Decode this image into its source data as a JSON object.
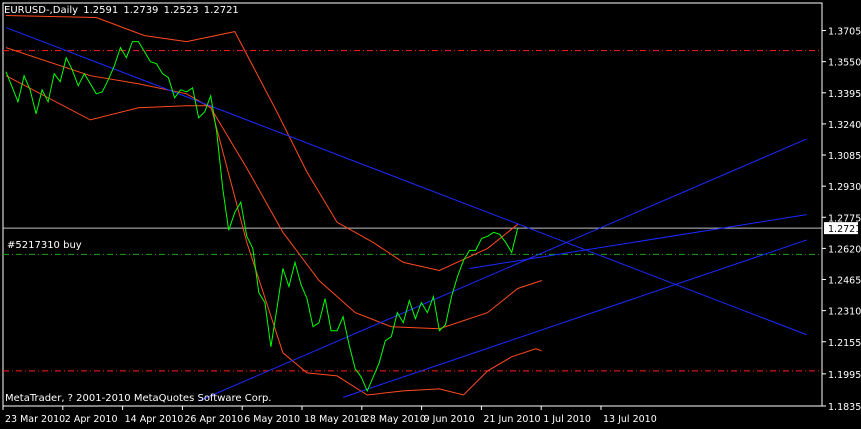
{
  "header": {
    "symbol": "EURUSD-,Daily",
    "open": "1.2591",
    "high": "1.2739",
    "low": "1.2523",
    "close": "1.2721"
  },
  "order_label": "#5217310 buy",
  "copyright": "MetaTrader, ? 2001-2010 MetaQuotes Software Corp.",
  "current_price": "1.2721",
  "colors": {
    "background": "#000000",
    "price": "#00ff00",
    "bands": "#ff4a1f",
    "trendlines": "#1a2aff",
    "levels": "#ff1e1e",
    "order_level": "#1fa01f",
    "current_price": "#c0c0c0",
    "text": "#ffffff"
  },
  "chart_data": {
    "type": "line",
    "symbol": "EURUSD-",
    "timeframe": "Daily",
    "ylim": [
      1.1835,
      1.377
    ],
    "y_ticks": [
      "1.3705",
      "1.3550",
      "1.3395",
      "1.3240",
      "1.3085",
      "1.2930",
      "1.2775",
      "1.2620",
      "1.2465",
      "1.2310",
      "1.2155",
      "1.1995",
      "1.1835"
    ],
    "x_ticks": [
      "23 Mar 2010",
      "2 Apr 2010",
      "14 Apr 2010",
      "26 Apr 2010",
      "6 May 2010",
      "18 May 2010",
      "28 May 2010",
      "9 Jun 2010",
      "21 Jun 2010",
      "1 Jul 2010",
      "13 Jul 2010"
    ],
    "horizontal_levels": [
      1.3605,
      1.201
    ],
    "order_level": 1.259,
    "current_price": 1.2721,
    "series": [
      {
        "kind": "price",
        "points": [
          [
            0,
            1.35
          ],
          [
            2,
            1.335
          ],
          [
            3,
            1.348
          ],
          [
            4,
            1.341
          ],
          [
            5,
            1.329
          ],
          [
            6,
            1.341
          ],
          [
            7,
            1.335
          ],
          [
            8,
            1.349
          ],
          [
            9,
            1.345
          ],
          [
            10,
            1.357
          ],
          [
            11,
            1.351
          ],
          [
            12,
            1.343
          ],
          [
            13,
            1.349
          ],
          [
            14,
            1.344
          ],
          [
            15,
            1.339
          ],
          [
            16,
            1.34
          ],
          [
            17,
            1.346
          ],
          [
            18,
            1.353
          ],
          [
            19,
            1.362
          ],
          [
            20,
            1.357
          ],
          [
            21,
            1.365
          ],
          [
            22,
            1.365
          ],
          [
            23,
            1.36
          ],
          [
            24,
            1.355
          ],
          [
            25,
            1.354
          ],
          [
            26,
            1.349
          ],
          [
            27,
            1.347
          ],
          [
            28,
            1.337
          ],
          [
            29,
            1.341
          ],
          [
            30,
            1.34
          ],
          [
            31,
            1.342
          ],
          [
            32,
            1.327
          ],
          [
            33,
            1.33
          ],
          [
            34,
            1.338
          ],
          [
            35,
            1.32
          ],
          [
            36,
            1.292
          ],
          [
            37,
            1.271
          ],
          [
            38,
            1.28
          ],
          [
            39,
            1.285
          ],
          [
            40,
            1.268
          ],
          [
            41,
            1.262
          ],
          [
            42,
            1.24
          ],
          [
            43,
            1.235
          ],
          [
            44,
            1.213
          ],
          [
            45,
            1.232
          ],
          [
            46,
            1.252
          ],
          [
            47,
            1.243
          ],
          [
            48,
            1.255
          ],
          [
            49,
            1.244
          ],
          [
            50,
            1.237
          ],
          [
            51,
            1.223
          ],
          [
            52,
            1.225
          ],
          [
            53,
            1.237
          ],
          [
            54,
            1.221
          ],
          [
            55,
            1.221
          ],
          [
            56,
            1.228
          ],
          [
            57,
            1.214
          ],
          [
            58,
            1.202
          ],
          [
            59,
            1.198
          ],
          [
            60,
            1.191
          ],
          [
            61,
            1.198
          ],
          [
            62,
            1.205
          ],
          [
            63,
            1.216
          ],
          [
            64,
            1.218
          ],
          [
            65,
            1.23
          ],
          [
            66,
            1.225
          ],
          [
            67,
            1.236
          ],
          [
            68,
            1.227
          ],
          [
            69,
            1.235
          ],
          [
            70,
            1.23
          ],
          [
            71,
            1.238
          ],
          [
            72,
            1.221
          ],
          [
            73,
            1.224
          ],
          [
            74,
            1.238
          ],
          [
            75,
            1.248
          ],
          [
            76,
            1.256
          ],
          [
            77,
            1.261
          ],
          [
            78,
            1.261
          ],
          [
            79,
            1.267
          ],
          [
            80,
            1.268
          ],
          [
            81,
            1.27
          ],
          [
            82,
            1.269
          ],
          [
            83,
            1.265
          ],
          [
            84,
            1.26
          ],
          [
            85,
            1.272
          ]
        ]
      },
      {
        "kind": "band",
        "points": [
          [
            0,
            1.378
          ],
          [
            15,
            1.377
          ],
          [
            23,
            1.368
          ],
          [
            30,
            1.365
          ],
          [
            38,
            1.37
          ],
          [
            45,
            1.33
          ],
          [
            50,
            1.3
          ],
          [
            55,
            1.275
          ],
          [
            61,
            1.265
          ],
          [
            66,
            1.255
          ],
          [
            72,
            1.251
          ],
          [
            80,
            1.262
          ],
          [
            85,
            1.274
          ]
        ]
      },
      {
        "kind": "band",
        "points": [
          [
            0,
            1.362
          ],
          [
            14,
            1.348
          ],
          [
            22,
            1.344
          ],
          [
            30,
            1.339
          ],
          [
            34,
            1.332
          ],
          [
            40,
            1.302
          ],
          [
            46,
            1.27
          ],
          [
            52,
            1.246
          ],
          [
            58,
            1.23
          ],
          [
            64,
            1.223
          ],
          [
            72,
            1.222
          ],
          [
            80,
            1.23
          ],
          [
            85,
            1.242
          ],
          [
            89,
            1.246
          ]
        ]
      },
      {
        "kind": "band",
        "points": [
          [
            0,
            1.348
          ],
          [
            14,
            1.326
          ],
          [
            22,
            1.332
          ],
          [
            30,
            1.333
          ],
          [
            34,
            1.333
          ],
          [
            40,
            1.265
          ],
          [
            46,
            1.21
          ],
          [
            50,
            1.2
          ],
          [
            55,
            1.1985
          ],
          [
            60,
            1.189
          ],
          [
            66,
            1.191
          ],
          [
            72,
            1.192
          ],
          [
            76,
            1.189
          ],
          [
            80,
            1.201
          ],
          [
            84,
            1.208
          ],
          [
            88,
            1.212
          ],
          [
            89,
            1.211
          ]
        ]
      }
    ],
    "trendlines": [
      {
        "from": [
          0,
          1.372
        ],
        "to": [
          133,
          1.219
        ]
      },
      {
        "from": [
          32,
          1.186
        ],
        "to": [
          133,
          1.3165
        ]
      },
      {
        "from": [
          56,
          1.1878
        ],
        "to": [
          133,
          1.2662
        ]
      },
      {
        "from": [
          77,
          1.252
        ],
        "to": [
          133,
          1.2788
        ]
      }
    ],
    "x_range": [
      -0.5,
      133
    ]
  }
}
